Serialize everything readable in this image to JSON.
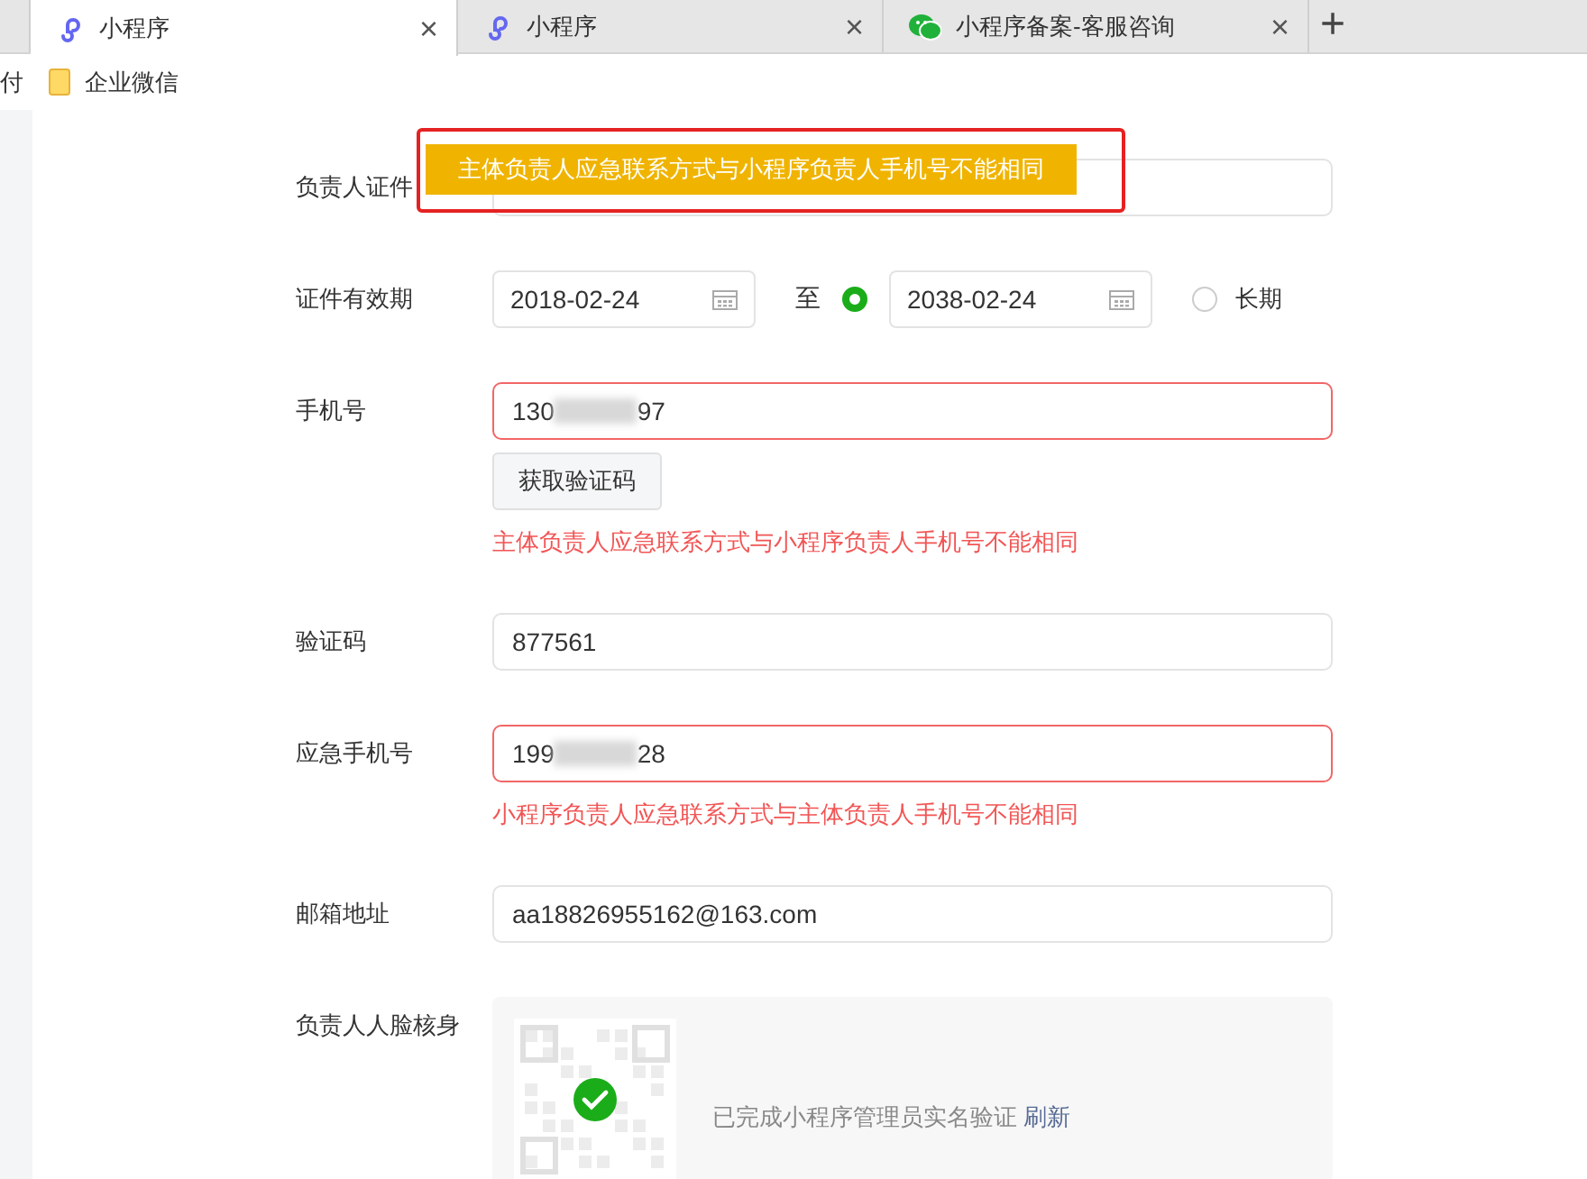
{
  "tabs": [
    {
      "title": "小程序",
      "close": "×",
      "selected": true
    },
    {
      "title": "小程序",
      "close": "×",
      "selected": false
    },
    {
      "title": "小程序备案-客服咨询",
      "close": "×",
      "selected": false
    }
  ],
  "new_tab": "+",
  "bookmarks": [
    {
      "kind": "text",
      "label": "付"
    },
    {
      "kind": "folder",
      "label": "企业微信"
    }
  ],
  "toast": {
    "message": "主体负责人应急联系方式与小程序负责人手机号不能相同",
    "highlighted": true
  },
  "form": [
    {
      "kind": "covered",
      "label": "负责人证件"
    },
    {
      "kind": "date_range",
      "label": "证件有效期",
      "start": "2018-02-24",
      "separator": "至",
      "end": {
        "selected": true,
        "date": "2038-02-24"
      },
      "long_term": {
        "selected": false,
        "label": "长期"
      }
    },
    {
      "kind": "phone",
      "label": "手机号",
      "value_start": "130",
      "value_end": "97",
      "invalid": true,
      "button": "获取验证码",
      "error": "主体负责人应急联系方式与小程序负责人手机号不能相同"
    },
    {
      "kind": "text",
      "label": "验证码",
      "value": "877561",
      "invalid": false
    },
    {
      "kind": "phone",
      "label": "应急手机号",
      "value_start": "199",
      "value_end": "28",
      "invalid": true,
      "error": "小程序负责人应急联系方式与主体负责人手机号不能相同"
    },
    {
      "kind": "text",
      "label": "邮箱地址",
      "value": "aa18826955162@163.com",
      "invalid": false
    },
    {
      "kind": "face",
      "label": "负责人人脸核身",
      "verified": true,
      "status": "已完成小程序管理员实名验证",
      "link": "刷新"
    }
  ]
}
